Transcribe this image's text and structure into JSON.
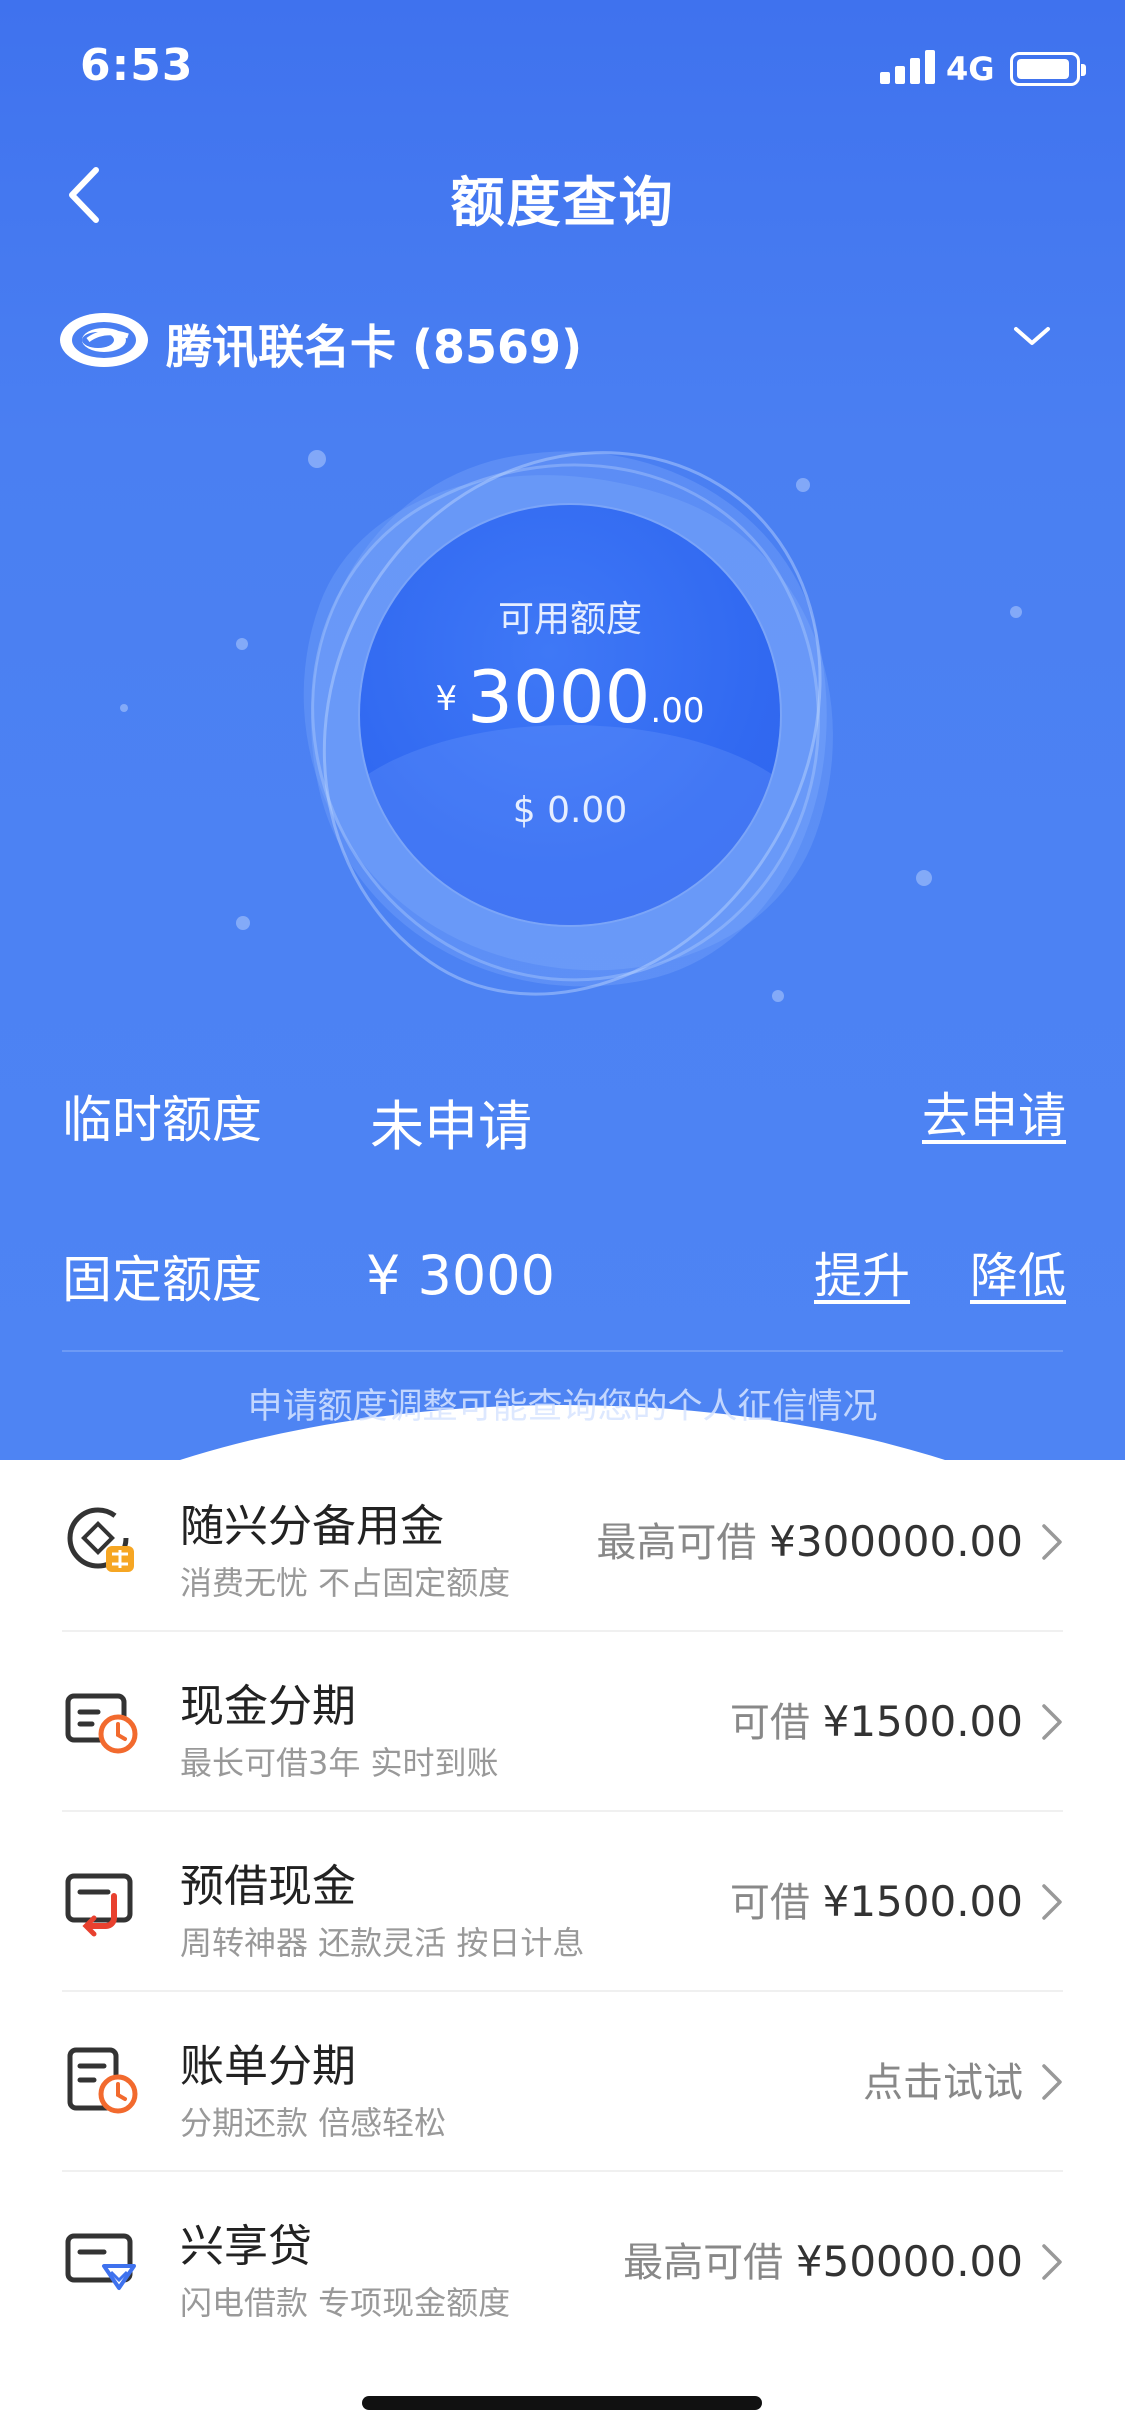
{
  "status_bar": {
    "time": "6:53",
    "network": "4G"
  },
  "nav": {
    "title": "额度查询"
  },
  "card": {
    "name": "腾讯联名卡 (8569)"
  },
  "credit": {
    "label": "可用额度",
    "currency_symbol": "¥",
    "amount_integer": "3000",
    "amount_decimal": ".00",
    "usd": "$ 0.00"
  },
  "temporary_quota": {
    "label": "临时额度",
    "value": "未申请",
    "action": "去申请"
  },
  "fixed_quota": {
    "label": "固定额度",
    "value": "¥ 3000",
    "raise": "提升",
    "lower": "降低"
  },
  "notice": "申请额度调整可能查询您的个人征信情况",
  "services": [
    {
      "title": "随兴分备用金",
      "subtitle": "消费无忧 不占固定额度",
      "prefix": "最高可借",
      "amount": "¥300000.00",
      "icon": "reserve-fund-icon"
    },
    {
      "title": "现金分期",
      "subtitle": "最长可借3年 实时到账",
      "prefix": "可借",
      "amount": "¥1500.00",
      "icon": "cash-installment-icon"
    },
    {
      "title": "预借现金",
      "subtitle": "周转神器 还款灵活 按日计息",
      "prefix": "可借",
      "amount": "¥1500.00",
      "icon": "cash-advance-icon"
    },
    {
      "title": "账单分期",
      "subtitle": "分期还款 倍感轻松",
      "prefix": "点击试试",
      "amount": "",
      "icon": "bill-installment-icon"
    },
    {
      "title": "兴享贷",
      "subtitle": "闪电借款 专项现金额度",
      "prefix": "最高可借",
      "amount": "¥50000.00",
      "icon": "loan-icon"
    }
  ],
  "colors": {
    "primary": "#4a7ff2",
    "accent_orange": "#f6a623",
    "accent_red": "#e8412f"
  }
}
